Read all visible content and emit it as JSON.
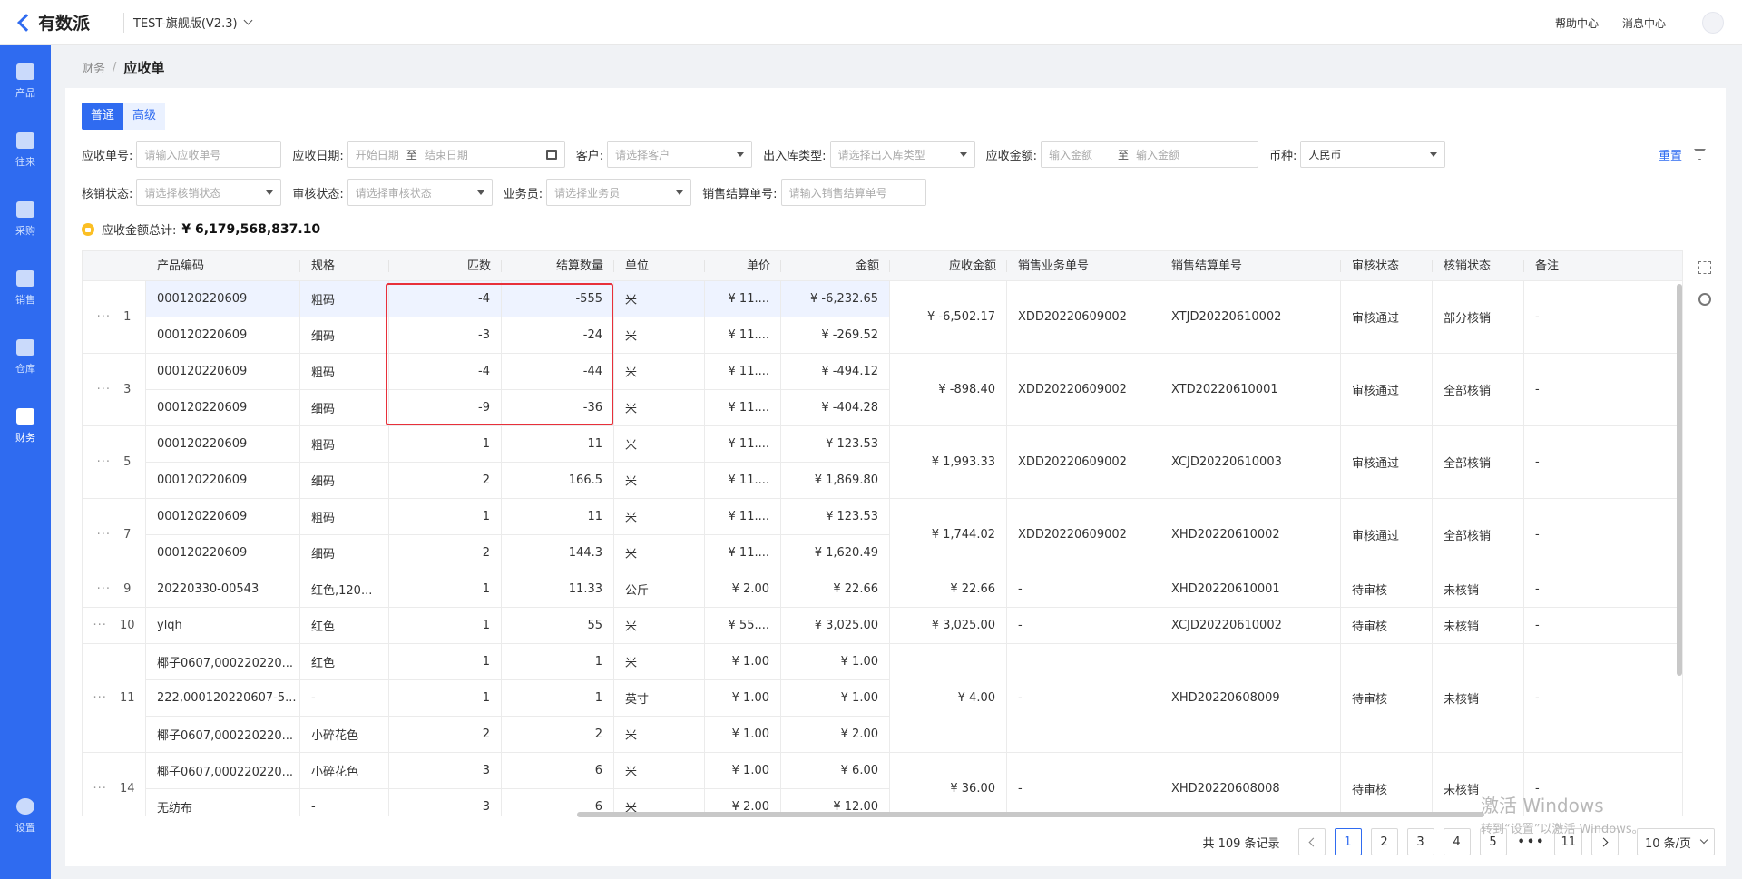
{
  "app": {
    "logo_text": "有数派",
    "env": "TEST-旗舰版(V2.3)"
  },
  "topbar": {
    "help": "帮助中心",
    "messages": "消息中心"
  },
  "sidebar": {
    "items": [
      {
        "label": "产品",
        "icon": "product-icon"
      },
      {
        "label": "往来",
        "icon": "contacts-icon"
      },
      {
        "label": "采购",
        "icon": "purchase-icon"
      },
      {
        "label": "销售",
        "icon": "sales-icon"
      },
      {
        "label": "仓库",
        "icon": "warehouse-icon"
      },
      {
        "label": "财务",
        "icon": "finance-icon",
        "active": true
      },
      {
        "label": "设置",
        "icon": "settings-icon"
      }
    ]
  },
  "breadcrumb": {
    "parent": "财务",
    "current": "应收单"
  },
  "tabs": {
    "normal": "普通",
    "advanced": "高级"
  },
  "filters": {
    "ar_no": {
      "label": "应收单号:",
      "placeholder": "请输入应收单号"
    },
    "ar_date": {
      "label": "应收日期:",
      "start": "开始日期",
      "sep": "至",
      "end": "结束日期"
    },
    "customer": {
      "label": "客户:",
      "placeholder": "请选择客户"
    },
    "io_type": {
      "label": "出入库类型:",
      "placeholder": "请选择出入库类型"
    },
    "amount": {
      "label": "应收金额:",
      "min": "输入金额",
      "sep": "至",
      "max": "输入金额"
    },
    "currency": {
      "label": "币种:",
      "value": "人民币"
    },
    "writeoff": {
      "label": "核销状态:",
      "placeholder": "请选择核销状态"
    },
    "audit": {
      "label": "审核状态:",
      "placeholder": "请选择审核状态"
    },
    "salesman": {
      "label": "业务员:",
      "placeholder": "请选择业务员"
    },
    "settle_no": {
      "label": "销售结算单号:",
      "placeholder": "请输入销售结算单号"
    },
    "reset": "重置"
  },
  "summary": {
    "label": "应收金额总计:",
    "value": "¥ 6,179,568,837.10"
  },
  "table": {
    "headers": {
      "code": "产品编码",
      "spec": "规格",
      "pieces": "匹数",
      "qty": "结算数量",
      "unit": "单位",
      "price": "单价",
      "amount": "金额",
      "ar_amount": "应收金额",
      "sales_no": "销售业务单号",
      "settle_no": "销售结算单号",
      "audit": "审核状态",
      "writeoff": "核销状态",
      "remark": "备注"
    },
    "groups": [
      {
        "index": "1",
        "ar_amount": "¥ -6,502.17",
        "sales_no": "XDD20220609002",
        "settle_no": "XTJD20220610002",
        "audit": "审核通过",
        "writeoff": "部分核销",
        "remark": "-",
        "lines": [
          {
            "code": "000120220609",
            "spec": "粗码",
            "pieces": "-4",
            "qty": "-555",
            "unit": "米",
            "price": "¥ 11....",
            "amount": "¥ -6,232.65"
          },
          {
            "code": "000120220609",
            "spec": "细码",
            "pieces": "-3",
            "qty": "-24",
            "unit": "米",
            "price": "¥ 11....",
            "amount": "¥ -269.52"
          }
        ]
      },
      {
        "index": "3",
        "ar_amount": "¥ -898.40",
        "sales_no": "XDD20220609002",
        "settle_no": "XTD20220610001",
        "audit": "审核通过",
        "writeoff": "全部核销",
        "remark": "-",
        "lines": [
          {
            "code": "000120220609",
            "spec": "粗码",
            "pieces": "-4",
            "qty": "-44",
            "unit": "米",
            "price": "¥ 11....",
            "amount": "¥ -494.12"
          },
          {
            "code": "000120220609",
            "spec": "细码",
            "pieces": "-9",
            "qty": "-36",
            "unit": "米",
            "price": "¥ 11....",
            "amount": "¥ -404.28"
          }
        ]
      },
      {
        "index": "5",
        "ar_amount": "¥ 1,993.33",
        "sales_no": "XDD20220609002",
        "settle_no": "XCJD20220610003",
        "audit": "审核通过",
        "writeoff": "全部核销",
        "remark": "-",
        "lines": [
          {
            "code": "000120220609",
            "spec": "粗码",
            "pieces": "1",
            "qty": "11",
            "unit": "米",
            "price": "¥ 11....",
            "amount": "¥ 123.53"
          },
          {
            "code": "000120220609",
            "spec": "细码",
            "pieces": "2",
            "qty": "166.5",
            "unit": "米",
            "price": "¥ 11....",
            "amount": "¥ 1,869.80"
          }
        ]
      },
      {
        "index": "7",
        "ar_amount": "¥ 1,744.02",
        "sales_no": "XDD20220609002",
        "settle_no": "XHD20220610002",
        "audit": "审核通过",
        "writeoff": "全部核销",
        "remark": "-",
        "lines": [
          {
            "code": "000120220609",
            "spec": "粗码",
            "pieces": "1",
            "qty": "11",
            "unit": "米",
            "price": "¥ 11....",
            "amount": "¥ 123.53"
          },
          {
            "code": "000120220609",
            "spec": "细码",
            "pieces": "2",
            "qty": "144.3",
            "unit": "米",
            "price": "¥ 11....",
            "amount": "¥ 1,620.49"
          }
        ]
      },
      {
        "index": "9",
        "ar_amount": "¥ 22.66",
        "sales_no": "-",
        "settle_no": "XHD20220610001",
        "audit": "待审核",
        "writeoff": "未核销",
        "remark": "-",
        "lines": [
          {
            "code": "20220330-00543",
            "spec": "红色,120...",
            "pieces": "1",
            "qty": "11.33",
            "unit": "公斤",
            "price": "¥ 2.00",
            "amount": "¥ 22.66"
          }
        ]
      },
      {
        "index": "10",
        "ar_amount": "¥ 3,025.00",
        "sales_no": "-",
        "settle_no": "XCJD20220610002",
        "audit": "待审核",
        "writeoff": "未核销",
        "remark": "-",
        "lines": [
          {
            "code": "ylqh",
            "spec": "红色",
            "pieces": "1",
            "qty": "55",
            "unit": "米",
            "price": "¥ 55....",
            "amount": "¥ 3,025.00"
          }
        ]
      },
      {
        "index": "11",
        "ar_amount": "¥ 4.00",
        "sales_no": "-",
        "settle_no": "XHD20220608009",
        "audit": "待审核",
        "writeoff": "未核销",
        "remark": "-",
        "lines": [
          {
            "code": "椰子0607,000220220...",
            "spec": "红色",
            "pieces": "1",
            "qty": "1",
            "unit": "米",
            "price": "¥ 1.00",
            "amount": "¥ 1.00"
          },
          {
            "code": "222,000120220607-5...",
            "spec": "-",
            "pieces": "1",
            "qty": "1",
            "unit": "英寸",
            "price": "¥ 1.00",
            "amount": "¥ 1.00"
          },
          {
            "code": "椰子0607,000220220...",
            "spec": "小碎花色",
            "pieces": "2",
            "qty": "2",
            "unit": "米",
            "price": "¥ 1.00",
            "amount": "¥ 2.00"
          }
        ]
      },
      {
        "index": "14",
        "ar_amount": "¥ 36.00",
        "sales_no": "-",
        "settle_no": "XHD20220608008",
        "audit": "待审核",
        "writeoff": "未核销",
        "remark": "-",
        "lines": [
          {
            "code": "椰子0607,000220220...",
            "spec": "小碎花色",
            "pieces": "3",
            "qty": "6",
            "unit": "米",
            "price": "¥ 1.00",
            "amount": "¥ 6.00"
          },
          {
            "code": "无纺布",
            "spec": "-",
            "pieces": "3",
            "qty": "6",
            "unit": "米",
            "price": "¥ 2.00",
            "amount": "¥ 12.00"
          }
        ]
      }
    ]
  },
  "pagination": {
    "total": "共 109 条记录",
    "pages": [
      "1",
      "2",
      "3",
      "4",
      "5"
    ],
    "ellipsis": "•••",
    "last": "11",
    "current": "1",
    "page_size": "10 条/页"
  },
  "watermark": {
    "line1": "激活 Windows",
    "line2": "转到“设置”以激活 Windows。"
  }
}
